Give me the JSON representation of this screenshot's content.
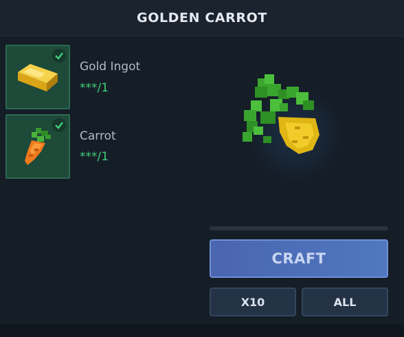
{
  "title": "GOLDEN CARROT",
  "ingredients": [
    {
      "name": "Gold Ingot",
      "count": "***/1",
      "icon": "gold-ingot-icon",
      "satisfied": true
    },
    {
      "name": "Carrot",
      "count": "***/1",
      "icon": "carrot-icon",
      "satisfied": true
    }
  ],
  "result_icon": "golden-carrot-icon",
  "progress": 0,
  "buttons": {
    "craft": "CRAFT",
    "x10": "X10",
    "all": "ALL"
  },
  "colors": {
    "accent_green": "#3ecf78",
    "craft_button": "#4f6fb8",
    "ingredient_slot": "#1e4a3a"
  }
}
